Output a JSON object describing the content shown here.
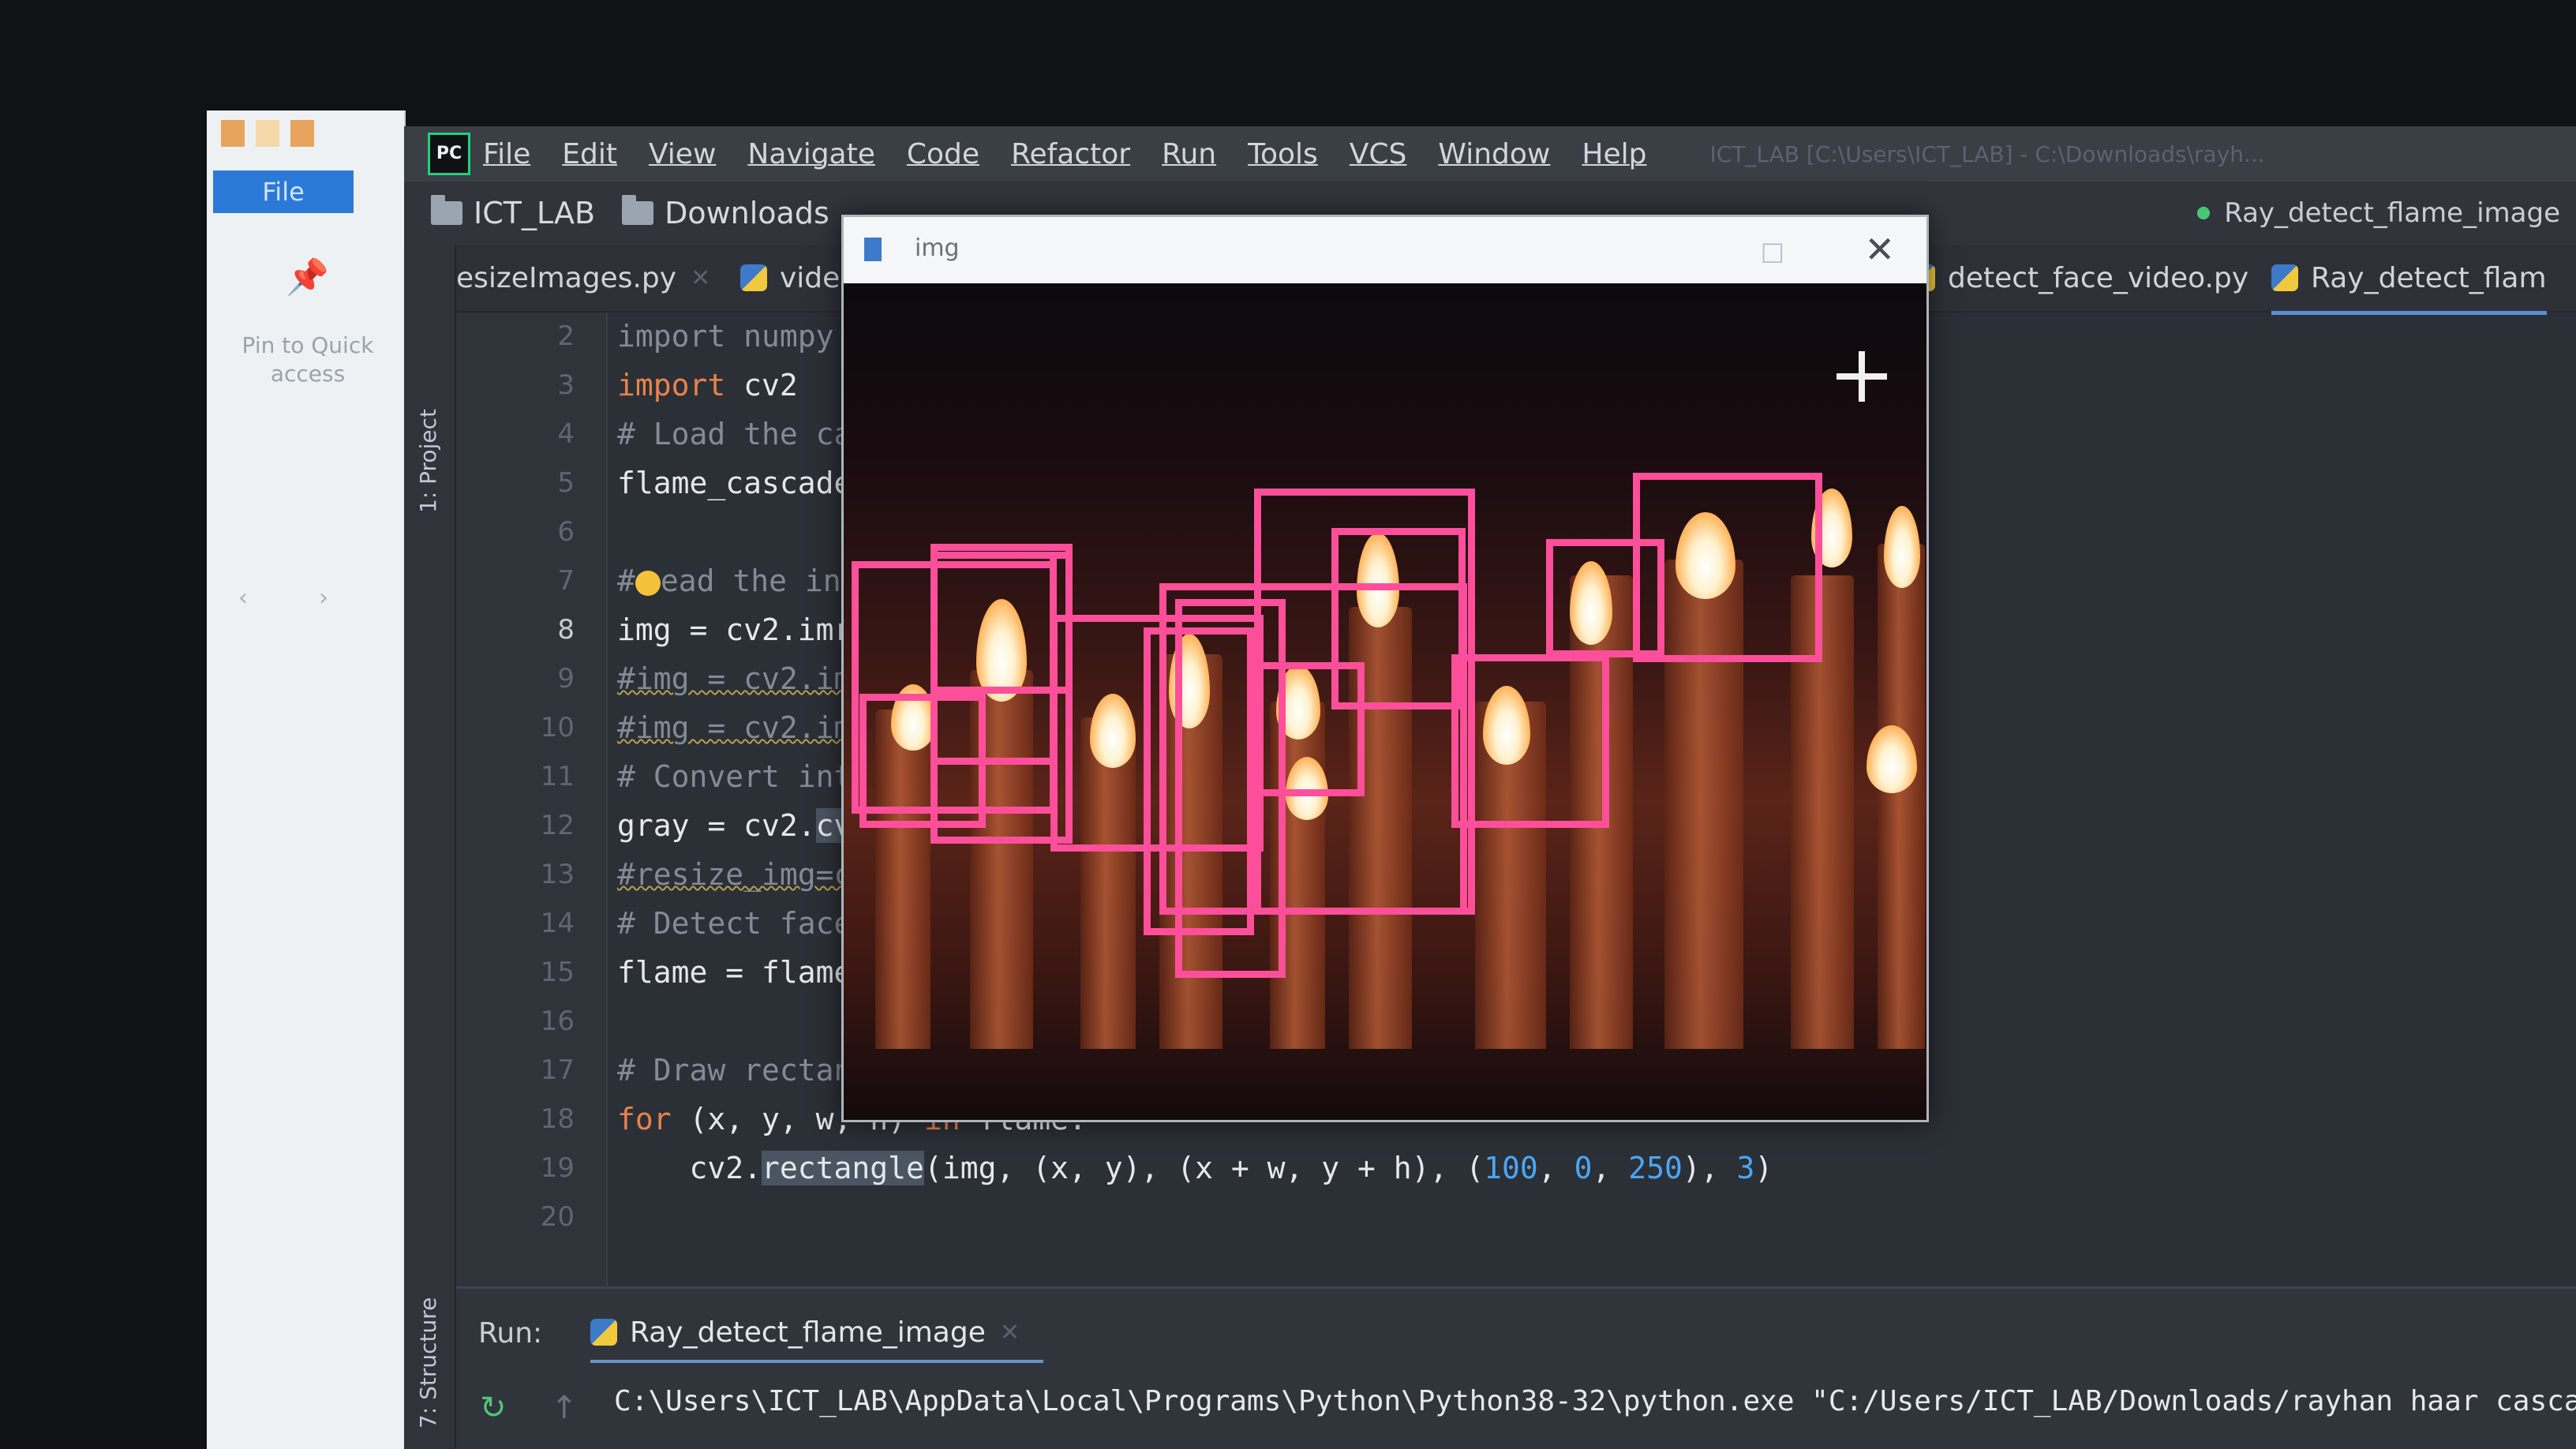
{
  "explorer": {
    "ribbon_tab": "File",
    "pin_label": "Pin to Quick access"
  },
  "ide": {
    "logo_text": "PC",
    "menu": [
      "File",
      "Edit",
      "View",
      "Navigate",
      "Code",
      "Refactor",
      "Run",
      "Tools",
      "VCS",
      "Window",
      "Help"
    ],
    "window_title": "ICT_LAB [C:\\Users\\ICT_LAB] - C:\\Downloads\\rayh...",
    "breadcrumb": [
      "ICT_LAB",
      "Downloads"
    ],
    "run_config": "Ray_detect_flame_image",
    "side_tools": {
      "project": "1: Project",
      "structure": "7: Structure"
    },
    "tabs": [
      {
        "label": "esizeImages.py",
        "active": false
      },
      {
        "label": "vide",
        "active": false
      },
      {
        "label": "detect_face_video.py",
        "active": false
      },
      {
        "label": "Ray_detect_flam",
        "active": true
      }
    ],
    "line_numbers": [
      "2",
      "3",
      "4",
      "5",
      "6",
      "7",
      "8",
      "9",
      "10",
      "11",
      "12",
      "13",
      "14",
      "15",
      "16",
      "17",
      "18",
      "19",
      "20"
    ],
    "current_line": "8",
    "code": {
      "l2": "import numpy",
      "l3_kw": "import",
      "l3_rest": " cv2",
      "l4": "# Load the ca",
      "l5": "flame_cascade",
      "l7_a": "#",
      "l7_b": "ead the in",
      "l8": "img = cv2.imr",
      "l9": "#img = cv2.im",
      "l10": "#img = cv2.im",
      "l11": "# Convert int",
      "l12_a": "gray = cv2.",
      "l12_b": "cv",
      "l13": "#resize_img=c",
      "l14": "# Detect face",
      "l15": "flame = flame",
      "l17": "# Draw rectan",
      "l18_kw": "for",
      "l18_rest": " (x, y, w, h) ",
      "l18_kw2": "in",
      "l18_rest2": " flame:",
      "l19_a": "    cv2.",
      "l19_b": "rectangle",
      "l19_c": "(img, (x, y), (x + w, y + h), (",
      "l19_n1": "100",
      "l19_s1": ", ",
      "l19_n2": "0",
      "l19_s2": ", ",
      "l19_n3": "250",
      "l19_s3": "), ",
      "l19_n4": "3",
      "l19_end": ")"
    },
    "run": {
      "label": "Run:",
      "tab": "Ray_detect_flame_image",
      "console": "C:\\Users\\ICT_LAB\\AppData\\Local\\Programs\\Python\\Python38-32\\python.exe \"C:/Users/ICT_LAB/Downloads/rayhan  haar cascad"
    }
  },
  "image_window": {
    "title": "img",
    "box_color": "#ff4f9a"
  }
}
